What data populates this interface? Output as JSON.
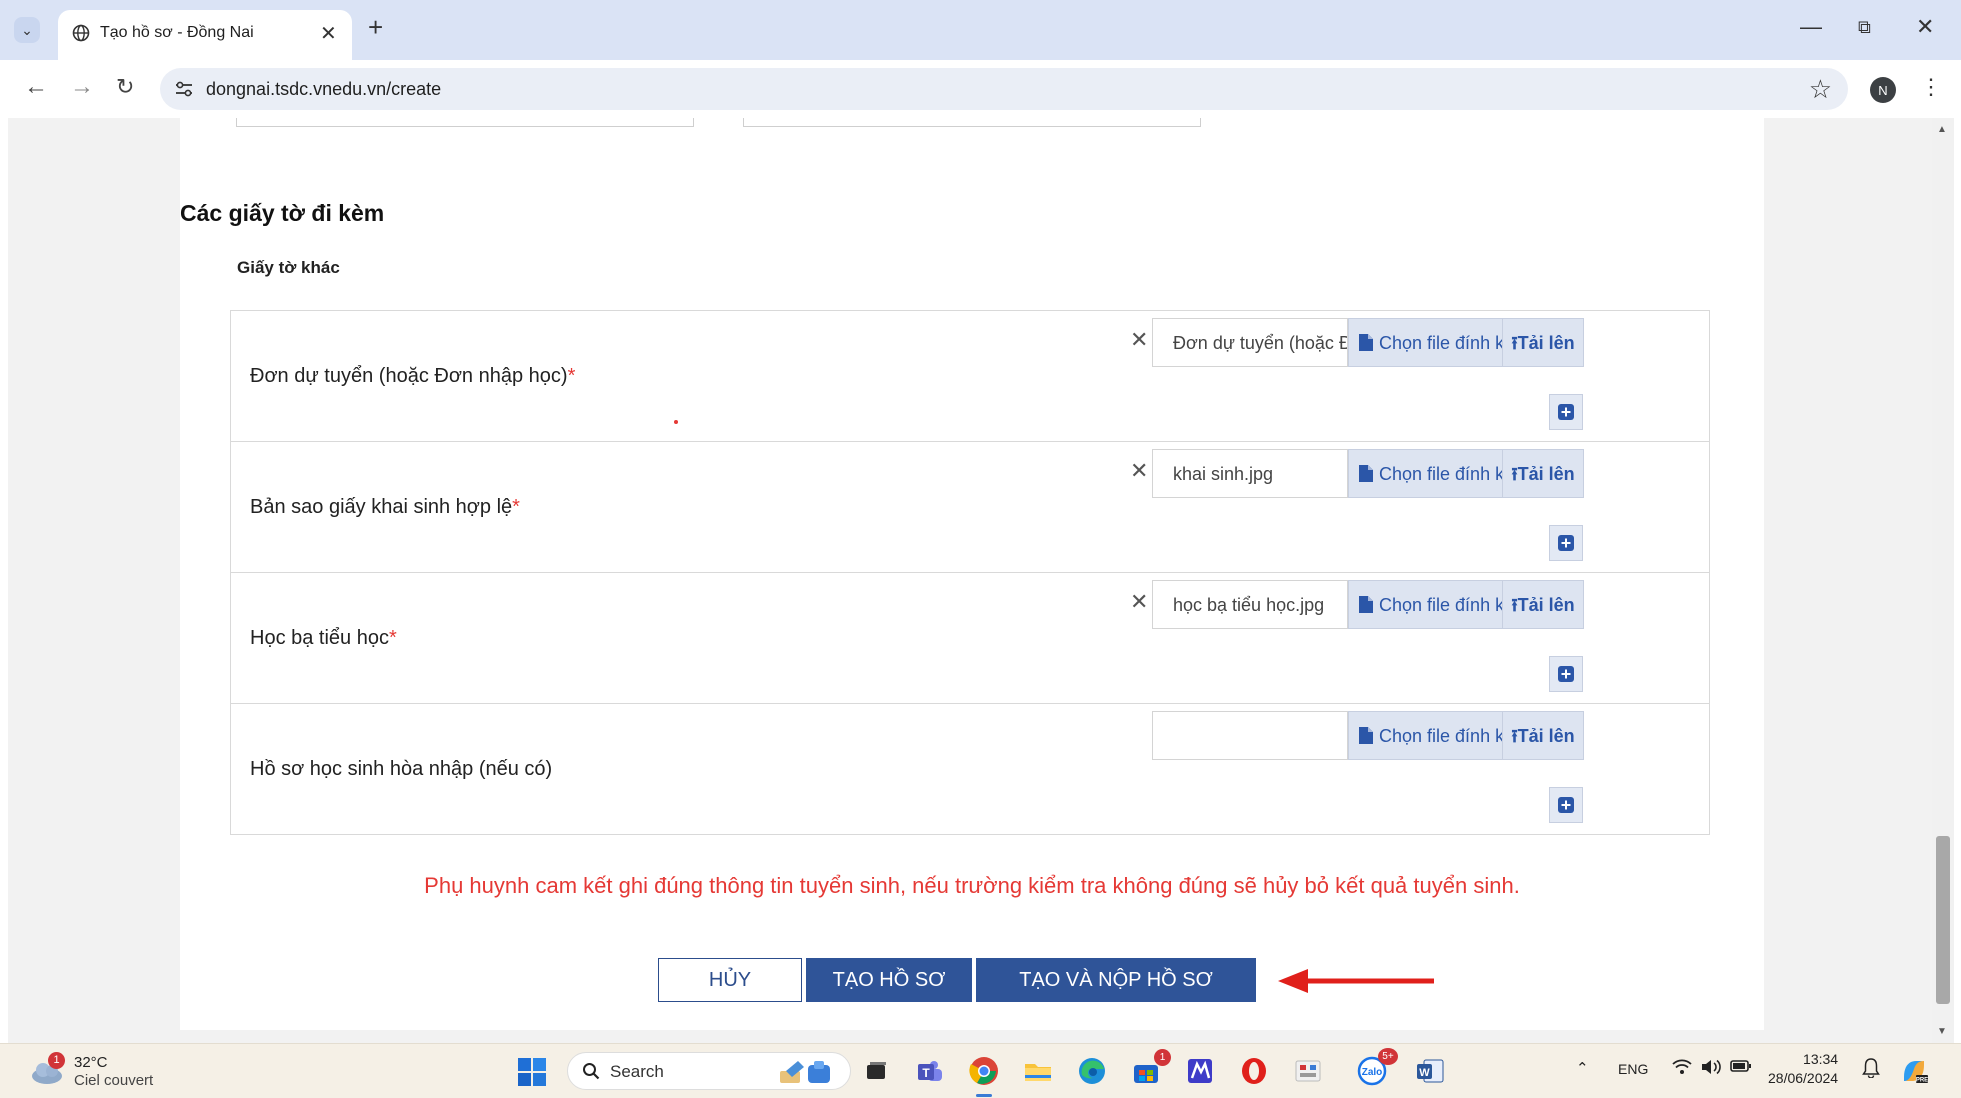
{
  "browser": {
    "tab_title": "Tạo hồ sơ - Đồng Nai",
    "url": "dongnai.tsdc.vnedu.vn/create",
    "profile_initial": "N"
  },
  "page": {
    "section_title": "Các giấy tờ đi kèm",
    "subsection_title": "Giấy tờ khác",
    "choose_file_label": "Chọn file đính kèm",
    "upload_label": "Tải lên",
    "documents": [
      {
        "label": "Đơn dự tuyển (hoặc Đơn nhập học)",
        "required": "*",
        "file_name": "Đơn dự tuyển (hoặc Đơn nh"
      },
      {
        "label": "Bản sao giấy khai sinh hợp lệ",
        "required": "*",
        "file_name": "khai sinh.jpg"
      },
      {
        "label": "Học bạ tiểu học",
        "required": "*",
        "file_name": "học bạ tiểu học.jpg"
      },
      {
        "label": "Hồ sơ học sinh hòa nhập (nếu có)",
        "required": "",
        "file_name": ""
      }
    ],
    "commitment_text": "Phụ huynh cam kết ghi đúng thông tin tuyển sinh, nếu trường kiểm tra không đúng sẽ hủy bỏ kết quả tuyển sinh.",
    "buttons": {
      "cancel": "HỦY",
      "create": "TẠO HỒ SƠ",
      "create_submit": "TẠO VÀ NỘP HỒ SƠ"
    }
  },
  "taskbar": {
    "weather_badge": "1",
    "temperature": "32°C",
    "condition": "Ciel couvert",
    "search_label": "Search",
    "language": "ENG",
    "time": "13:34",
    "date": "28/06/2024",
    "store_badge": "1",
    "zalo_badge": "5+"
  },
  "colors": {
    "primary_button": "#2f5498",
    "warning_text": "#e53935",
    "annotation_arrow": "#e0201b"
  }
}
